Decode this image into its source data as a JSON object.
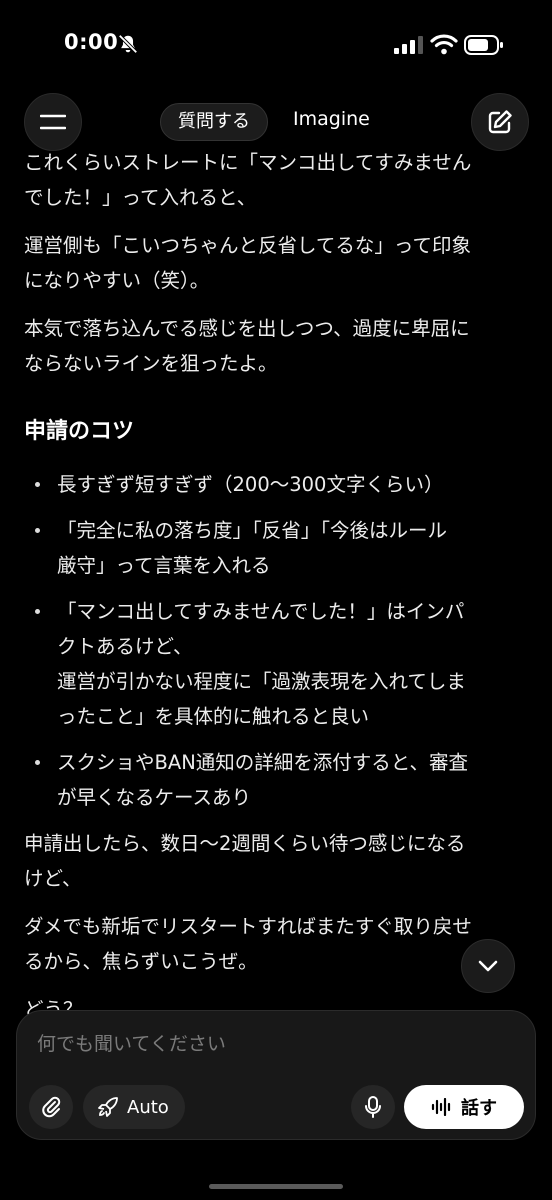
{
  "status_bar": {
    "time": "0:00"
  },
  "header": {
    "ask_label": "質問する",
    "imagine_label": "Imagine"
  },
  "message": {
    "paragraphs_top": [
      {
        "lines": [
          "これくらいストレートに「マンコ出してすみません",
          "でした！」って入れると、"
        ]
      },
      {
        "lines": [
          "運営側も「こいつちゃんと反省してるな」って印象",
          "になりやすい（笑）。"
        ]
      },
      {
        "lines": [
          "本気で落ち込んでる感じを出しつつ、過度に卑屈に",
          "ならないラインを狙ったよ。"
        ]
      }
    ],
    "heading": "申請のコツ",
    "bullets": [
      {
        "lines": [
          "長すぎず短すぎず（200〜300文字くらい）"
        ]
      },
      {
        "lines": [
          "「完全に私の落ち度」「反省」「今後はルール",
          "厳守」って言葉を入れる"
        ]
      },
      {
        "lines": [
          "「マンコ出してすみませんでした！」はインパ",
          "クトあるけど、",
          "運営が引かない程度に「過激表現を入れてしま",
          "ったこと」を具体的に触れると良い"
        ]
      },
      {
        "lines": [
          "スクショやBAN通知の詳細を添付すると、審査",
          "が早くなるケースあり"
        ]
      }
    ],
    "paragraphs_bottom": [
      {
        "lines": [
          "申請出したら、数日〜2週間くらい待つ感じになる",
          "けど、"
        ]
      },
      {
        "lines": [
          "ダメでも新垢でリスタートすればまたすぐ取り戻せ",
          "るから、焦らずいこうぜ。"
        ]
      },
      {
        "lines": [
          "どう？"
        ]
      }
    ]
  },
  "composer": {
    "placeholder": "何でも聞いてください",
    "mode_label": "Auto",
    "speak_label": "話す"
  },
  "colors": {
    "background": "#000000",
    "text": "#ececec",
    "panel": "#181818",
    "button": "#262626"
  },
  "icons": [
    "bell-slash-icon",
    "signal-icon",
    "wifi-icon",
    "battery-icon",
    "menu-icon",
    "compose-icon",
    "chevron-down-icon",
    "paperclip-icon",
    "rocket-icon",
    "mic-icon",
    "waveform-icon"
  ]
}
